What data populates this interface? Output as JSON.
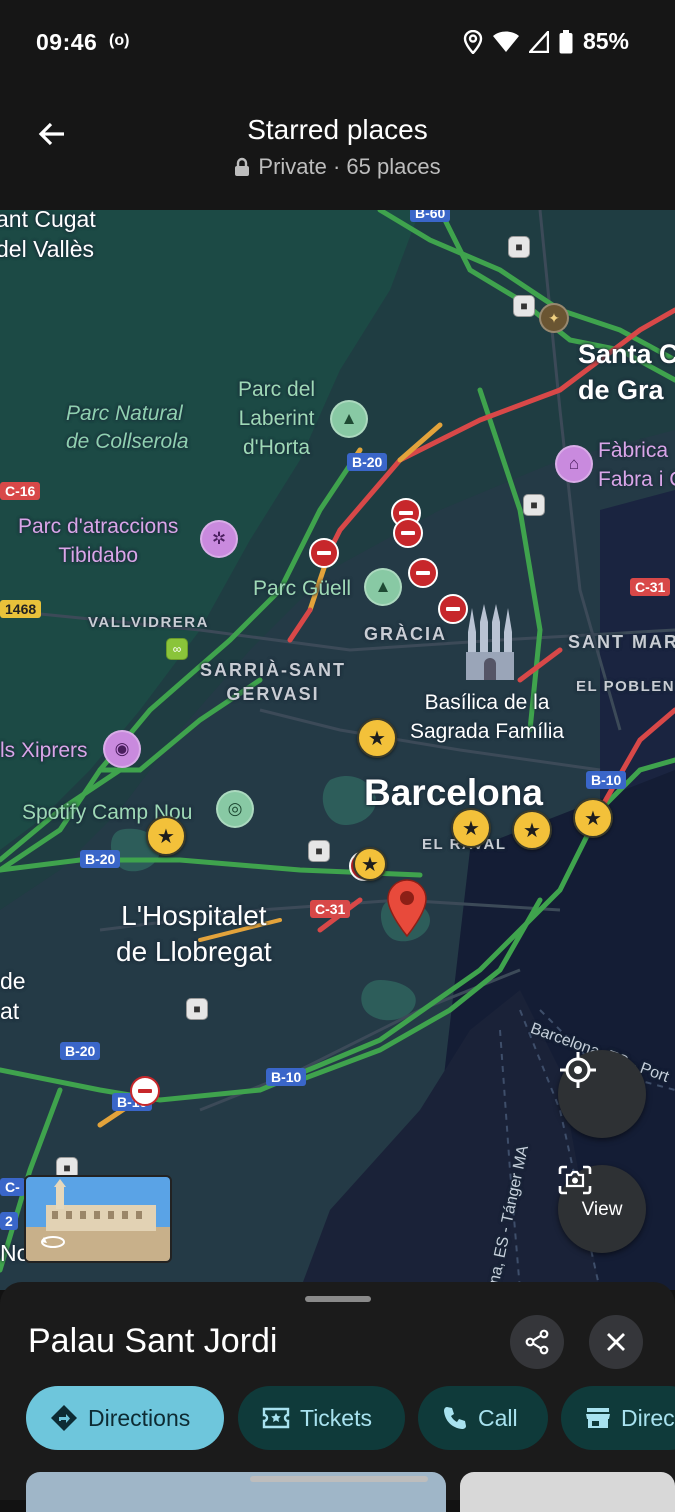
{
  "status": {
    "time": "09:46",
    "cast_icon": "(o)",
    "battery": "85%"
  },
  "header": {
    "title": "Starred places",
    "subtitle": "Private · 65 places"
  },
  "map": {
    "parks": {
      "collserola": [
        "Parc Natural",
        "de Collserola"
      ]
    },
    "pois": {
      "laberint": [
        "Parc del",
        "Laberint",
        "d'Horta"
      ],
      "tibidabo": [
        "Parc d'atraccions",
        "Tibidabo"
      ],
      "guell": "Parc Güell",
      "fabrica": [
        "Fàbrica",
        "Fabra i C"
      ],
      "xiprers": "ls Xiprers",
      "spotify": "Spotify Camp Nou",
      "sagrada": [
        "Basílica de la",
        "Sagrada Família"
      ]
    },
    "places": {
      "cugat": [
        "ant Cugat",
        "del Vallès"
      ],
      "santa": [
        "Santa C",
        "de Gra"
      ],
      "barcelona": "Barcelona",
      "hospitalet": [
        "L'Hospitalet",
        "de Llobregat"
      ],
      "de_edge": [
        "de",
        "at"
      ],
      "no_edge": "No"
    },
    "districts": {
      "vallvidrera": "VALLVIDRERA",
      "gracia": "GRÀCIA",
      "sarria": [
        "SARRIÀ-SANT",
        "GERVASI"
      ],
      "santmar": "SANT MAR",
      "poblenou": "EL POBLENO",
      "raval": "EL RAVAL"
    },
    "roads": {
      "b20_top": "B-20",
      "b20_west": "B-20",
      "b20_south": "B-20",
      "b10_east": "B-10",
      "b10_south": "B-10",
      "b10_sw": "B-10",
      "c16": "C-16",
      "c31_east": "C-31",
      "c31_center": "C-31",
      "r1468": "1468",
      "c_edge": "C-",
      "num_edge": "2",
      "b60_top": "B-60"
    },
    "sea_labels": {
      "port": "Barcelona, ES - Port",
      "tanger": "na, ES - Tánger MA"
    },
    "buttons": {
      "view_label": "View"
    }
  },
  "sheet": {
    "place_name": "Palau Sant Jordi",
    "chips": {
      "directions": "Directions",
      "tickets": "Tickets",
      "call": "Call",
      "direc": "Direc"
    }
  }
}
